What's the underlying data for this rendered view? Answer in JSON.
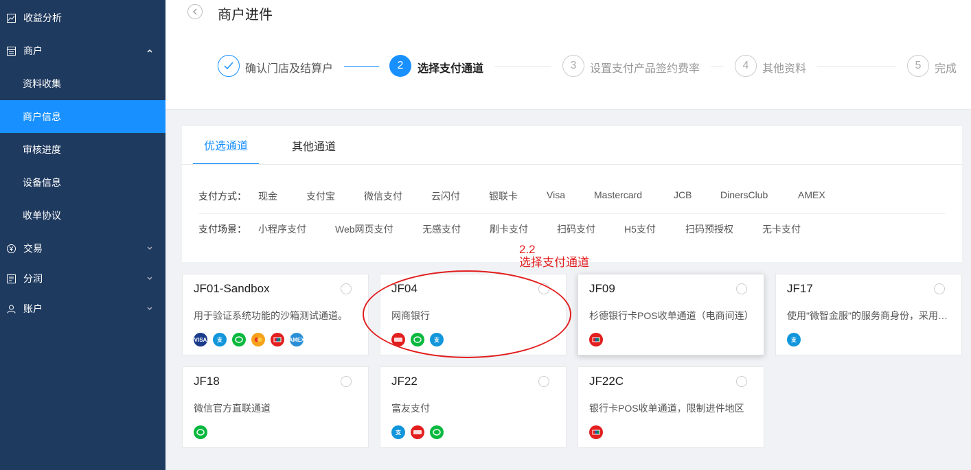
{
  "sidebar": {
    "items": [
      {
        "label": "收益分析",
        "icon": "chart-icon"
      },
      {
        "label": "商户",
        "icon": "store-icon"
      },
      {
        "label": "资料收集"
      },
      {
        "label": "商户信息"
      },
      {
        "label": "审核进度"
      },
      {
        "label": "设备信息"
      },
      {
        "label": "收单协议"
      },
      {
        "label": "交易",
        "icon": "yen-icon"
      },
      {
        "label": "分润",
        "icon": "ledger-icon"
      },
      {
        "label": "账户",
        "icon": "user-icon"
      }
    ]
  },
  "header": {
    "title": "商户进件",
    "steps": [
      {
        "number": "",
        "label": "确认门店及结算户",
        "status": "done"
      },
      {
        "number": "2",
        "label": "选择支付通道",
        "status": "current"
      },
      {
        "number": "3",
        "label": "设置支付产品签约费率",
        "status": "wait"
      },
      {
        "number": "4",
        "label": "其他资料",
        "status": "wait"
      },
      {
        "number": "5",
        "label": "完成",
        "status": "wait"
      }
    ]
  },
  "tabs": [
    "优选通道",
    "其他通道"
  ],
  "filters": {
    "method_label": "支付方式：",
    "methods": [
      "现金",
      "支付宝",
      "微信支付",
      "云闪付",
      "银联卡",
      "Visa",
      "Mastercard",
      "JCB",
      "DinersClub",
      "AMEX"
    ],
    "scene_label": "支付场景：",
    "scenes": [
      "小程序支付",
      "Web网页支付",
      "无感支付",
      "刷卡支付",
      "扫码支付",
      "H5支付",
      "扫码预授权",
      "无卡支付"
    ]
  },
  "channels": [
    {
      "title": "JF01-Sandbox",
      "desc": "用于验证系统功能的沙箱测试通道。",
      "icons": [
        "visa-icon",
        "alipay-icon",
        "wechat-icon",
        "mastercard-icon",
        "unionpay-icon",
        "amex-icon"
      ]
    },
    {
      "title": "JF04",
      "desc": "网商银行",
      "icons": [
        "quickpass-icon",
        "wechat-icon",
        "alipay-icon"
      ]
    },
    {
      "title": "JF09",
      "desc": "杉德银行卡POS收单通道（电商间连）",
      "icons": [
        "unionpay-icon"
      ]
    },
    {
      "title": "JF17",
      "desc": "使用\"微智金服\"的服务商身份，采用支付宝间连",
      "icons": [
        "alipay-icon"
      ]
    },
    {
      "title": "JF18",
      "desc": "微信官方直联通道",
      "icons": [
        "wechat-icon"
      ]
    },
    {
      "title": "JF22",
      "desc": "富友支付",
      "icons": [
        "alipay-icon",
        "quickpass-icon",
        "wechat-icon"
      ]
    },
    {
      "title": "JF22C",
      "desc": "银行卡POS收单通道，限制进件地区",
      "icons": [
        "unionpay-icon"
      ]
    }
  ],
  "annotation": {
    "line1": "2.2",
    "line2": "选择支付通道",
    "color": "#e21e1e"
  },
  "colors": {
    "sidebar": "#1f3a5f",
    "accent": "#1890ff"
  }
}
